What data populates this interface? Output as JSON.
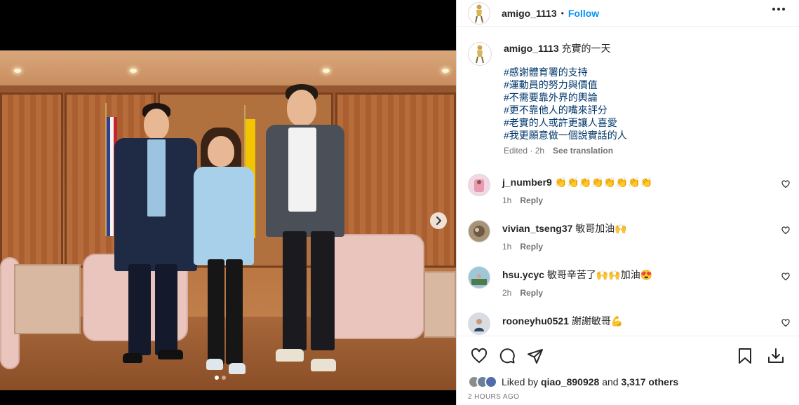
{
  "post": {
    "author": "amigo_1113",
    "follow_label": "Follow",
    "dot_separator": "•",
    "caption_text": "充實的一天",
    "hashtags": [
      "#感謝體育署的支持",
      "#運動員的努力與價值",
      "#不需要靠外界的輿論",
      "#更不靠他人的嘴來評分",
      "#老實的人或許更讓人喜愛",
      "#我更願意做一個說實話的人"
    ],
    "edited_label": "Edited · 2h",
    "see_translation_label": "See translation"
  },
  "comments": [
    {
      "user": "j_number9",
      "text": "👏👏👏👏👏👏👏👏",
      "time": "1h",
      "reply_label": "Reply"
    },
    {
      "user": "vivian_tseng37",
      "text": "敏哥加油🙌",
      "time": "1h",
      "reply_label": "Reply"
    },
    {
      "user": "hsu.ycyc",
      "text": "敏哥辛苦了🙌🙌加油😍",
      "time": "2h",
      "reply_label": "Reply"
    },
    {
      "user": "rooneyhu0521",
      "text": "謝謝敏哥💪",
      "time": "",
      "reply_label": ""
    }
  ],
  "likes": {
    "prefix": "Liked by",
    "user": "qiao_890928",
    "connector": "and",
    "others": "3,317 others"
  },
  "timestamp": "2 HOURS AGO",
  "carousel": {
    "slides": 2,
    "active": 0
  },
  "icons": {
    "like": "heart-icon",
    "comment": "comment-icon",
    "share": "share-icon",
    "save": "bookmark-icon",
    "download": "download-icon",
    "more": "more-options-icon",
    "next": "chevron-right-icon"
  },
  "colors": {
    "link": "#0095f6",
    "hashtag": "#00376b",
    "muted": "#737373"
  }
}
